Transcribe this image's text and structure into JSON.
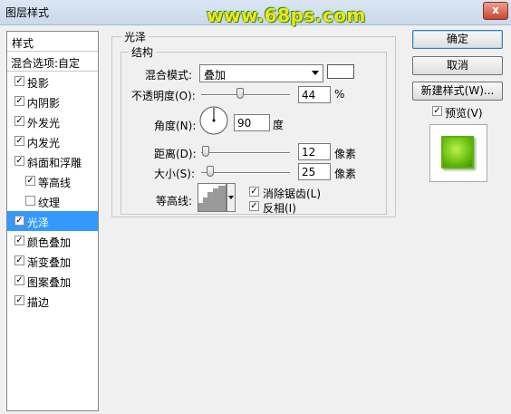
{
  "window": {
    "title": "图层样式",
    "close_label": "x"
  },
  "watermark": "www.68ps.com",
  "left_panel": {
    "header": "样式",
    "blend_options": "混合选项:自定",
    "items": [
      {
        "label": "投影",
        "checked": true,
        "selected": false,
        "indent": false
      },
      {
        "label": "内阴影",
        "checked": true,
        "selected": false,
        "indent": false
      },
      {
        "label": "外发光",
        "checked": true,
        "selected": false,
        "indent": false
      },
      {
        "label": "内发光",
        "checked": true,
        "selected": false,
        "indent": false
      },
      {
        "label": "斜面和浮雕",
        "checked": true,
        "selected": false,
        "indent": false
      },
      {
        "label": "等高线",
        "checked": true,
        "selected": false,
        "indent": true
      },
      {
        "label": "纹理",
        "checked": false,
        "selected": false,
        "indent": true
      },
      {
        "label": "光泽",
        "checked": true,
        "selected": true,
        "indent": false
      },
      {
        "label": "颜色叠加",
        "checked": true,
        "selected": false,
        "indent": false
      },
      {
        "label": "渐变叠加",
        "checked": true,
        "selected": false,
        "indent": false
      },
      {
        "label": "图案叠加",
        "checked": true,
        "selected": false,
        "indent": false
      },
      {
        "label": "描边",
        "checked": true,
        "selected": false,
        "indent": false
      }
    ]
  },
  "satin": {
    "title": "光泽",
    "structure_title": "结构",
    "blend_mode_label": "混合模式:",
    "blend_mode_value": "叠加",
    "opacity_label": "不透明度(O):",
    "opacity_value": "44",
    "opacity_unit": "%",
    "opacity_fraction": 0.44,
    "angle_label": "角度(N):",
    "angle_value": "90",
    "angle_unit": "度",
    "distance_label": "距离(D):",
    "distance_value": "12",
    "distance_unit": "像素",
    "distance_fraction": 0.05,
    "size_label": "大小(S):",
    "size_value": "25",
    "size_unit": "像素",
    "size_fraction": 0.1,
    "contour_label": "等高线:",
    "anti_alias_label": "消除锯齿(L)",
    "anti_alias_checked": true,
    "invert_label": "反相(I)",
    "invert_checked": true
  },
  "buttons": {
    "ok": "确定",
    "cancel": "取消",
    "new_style": "新建样式(W)..."
  },
  "preview": {
    "label": "预览(V)",
    "checked": true
  },
  "check_mark": "✓"
}
